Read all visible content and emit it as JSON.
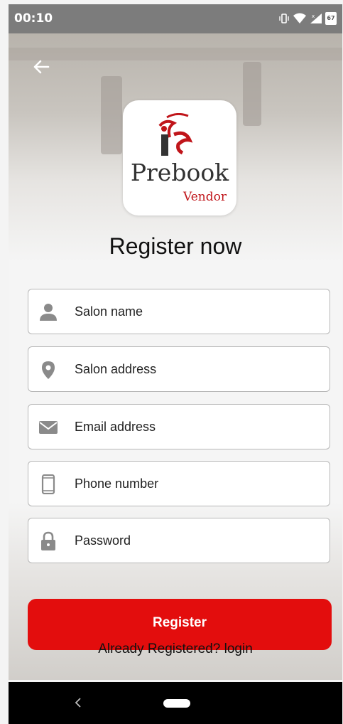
{
  "status_bar": {
    "time": "00:10",
    "battery_level": "67"
  },
  "logo": {
    "title": "Prebook",
    "subtitle": "Vendor"
  },
  "page_title": "Register now",
  "form": {
    "fields": [
      {
        "name": "salon-name",
        "placeholder": "Salon name",
        "icon": "person-icon"
      },
      {
        "name": "salon-address",
        "placeholder": "Salon address",
        "icon": "location-pin-icon"
      },
      {
        "name": "email-address",
        "placeholder": "Email address",
        "icon": "envelope-icon"
      },
      {
        "name": "phone-number",
        "placeholder": "Phone number",
        "icon": "phone-icon"
      },
      {
        "name": "password",
        "placeholder": "Password",
        "icon": "lock-icon"
      }
    ],
    "register_label": "Register",
    "login_link": "Already Registered? login"
  },
  "colors": {
    "accent": "#e30d0d",
    "logo_red": "#c0151a",
    "icon_gray": "#8a8a8a"
  }
}
